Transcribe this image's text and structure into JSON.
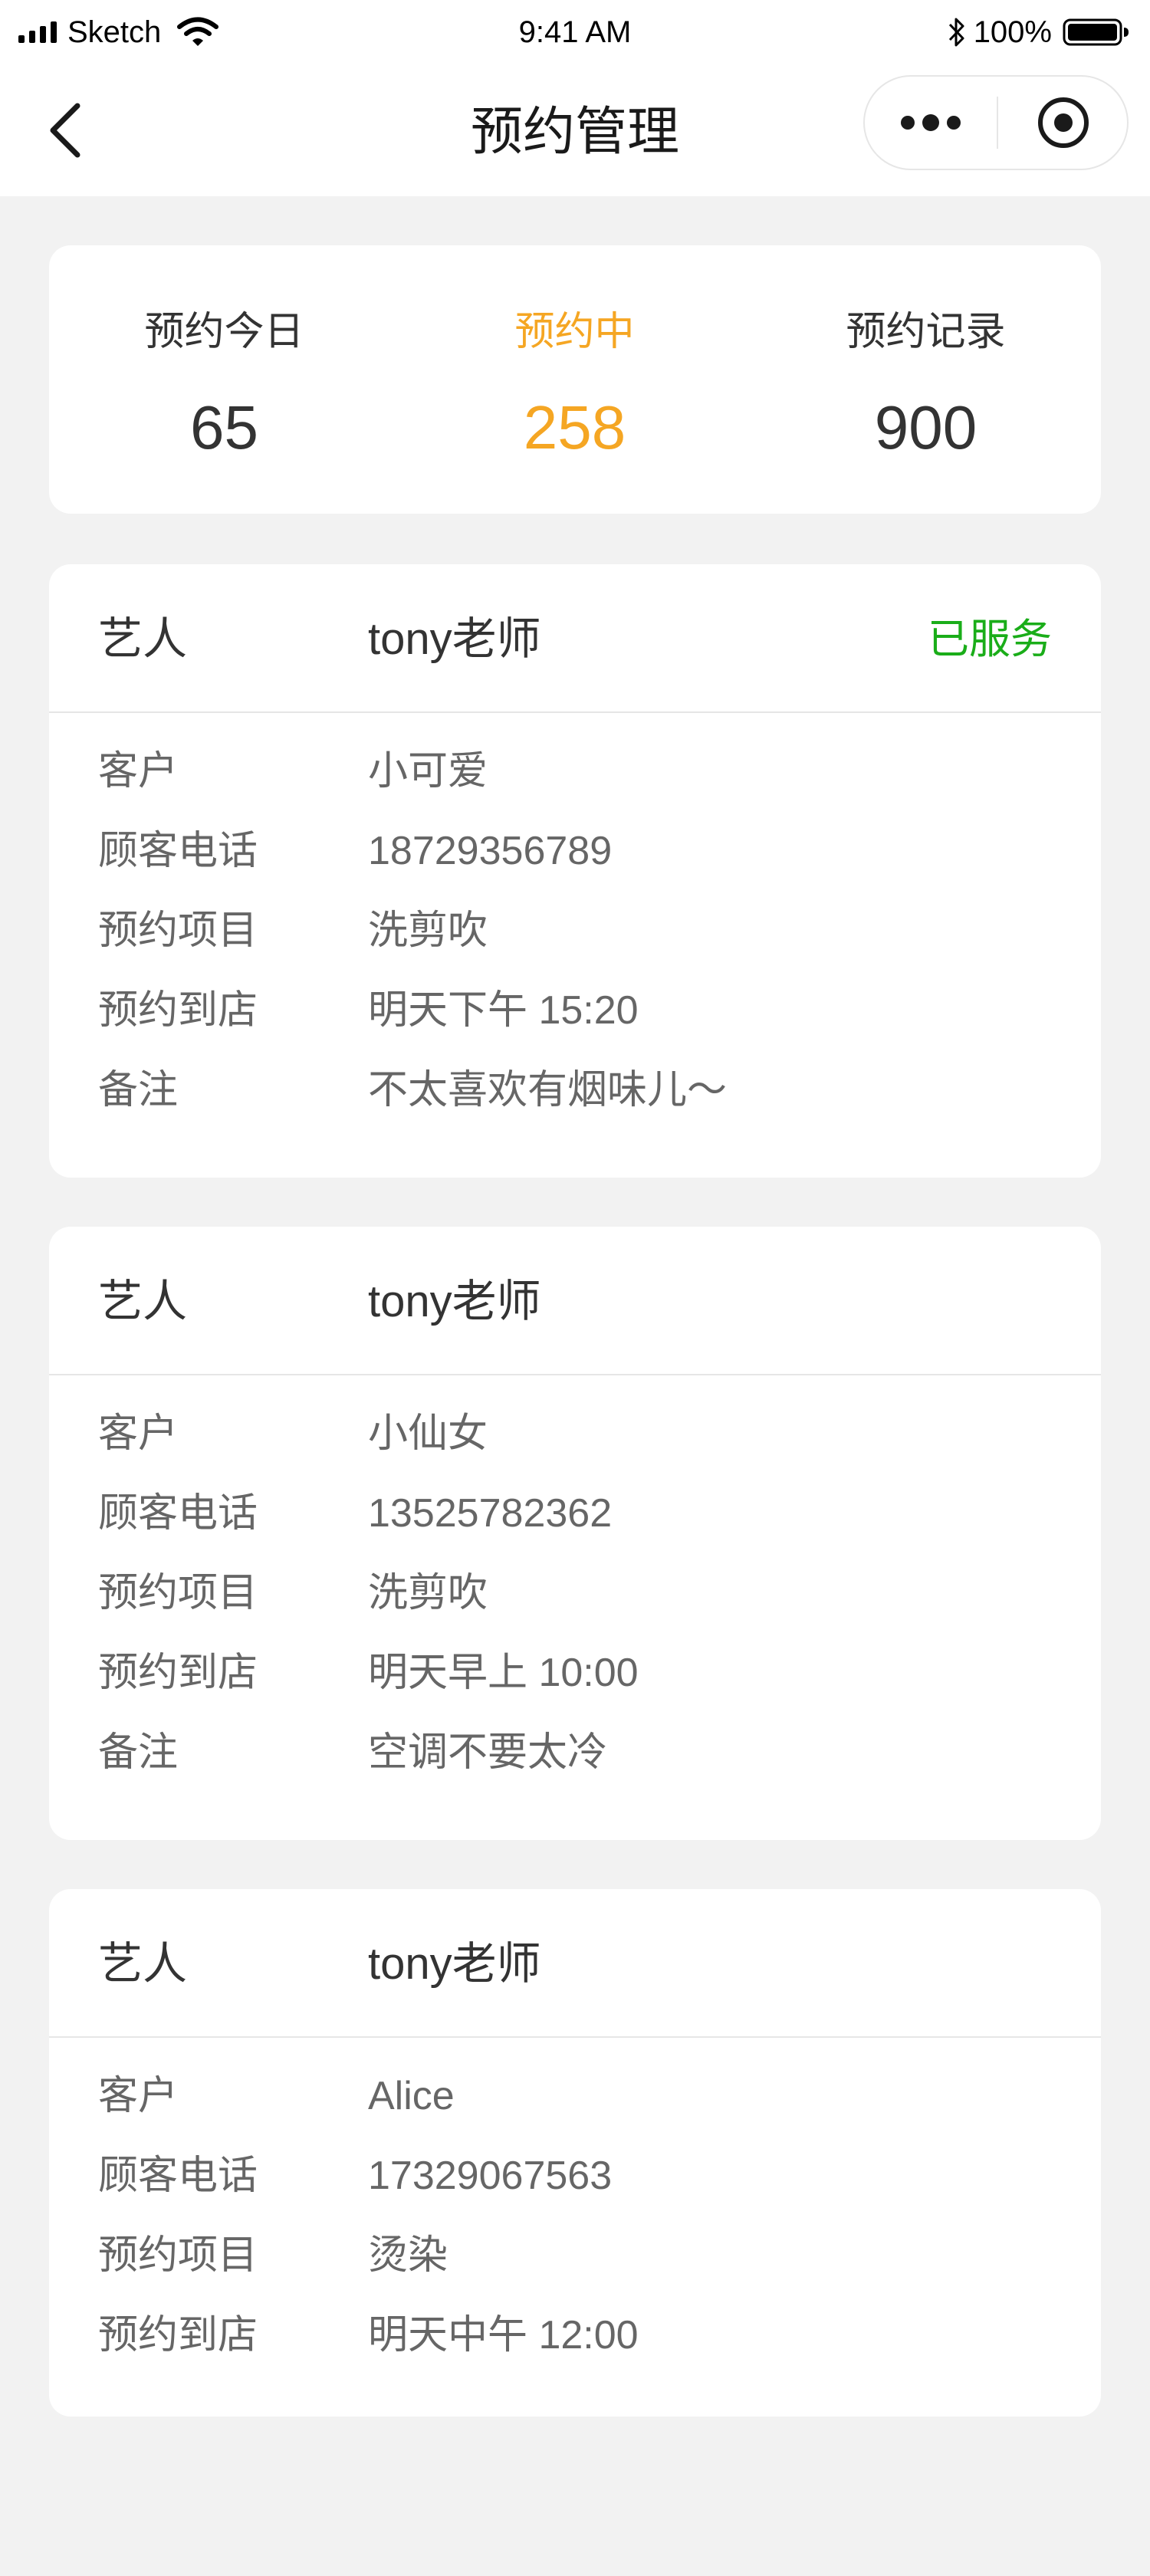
{
  "status_bar": {
    "carrier": "Sketch",
    "time": "9:41 AM",
    "battery": "100%"
  },
  "nav": {
    "title": "预约管理"
  },
  "stats": [
    {
      "label": "预约今日",
      "value": "65"
    },
    {
      "label": "预约中",
      "value": "258",
      "active": true
    },
    {
      "label": "预约记录",
      "value": "900"
    }
  ],
  "colors": {
    "accent": "#f5a623",
    "status_done": "#1aad19",
    "background": "#f2f2f2"
  },
  "field_labels": {
    "artist": "艺人",
    "customer": "客户",
    "phone": "顾客电话",
    "service": "预约项目",
    "arrival": "预约到店",
    "note": "备注"
  },
  "bookings": [
    {
      "artist": "tony老师",
      "status": "已服务",
      "customer": "小可爱",
      "phone": "18729356789",
      "service": "洗剪吹",
      "arrival": "明天下午 15:20",
      "note": "不太喜欢有烟味儿～"
    },
    {
      "artist": "tony老师",
      "customer": "小仙女",
      "phone": "13525782362",
      "service": "洗剪吹",
      "arrival": "明天早上 10:00",
      "note": "空调不要太冷"
    },
    {
      "artist": "tony老师",
      "customer": "Alice",
      "phone": "17329067563",
      "service": "烫染",
      "arrival": "明天中午 12:00"
    }
  ]
}
